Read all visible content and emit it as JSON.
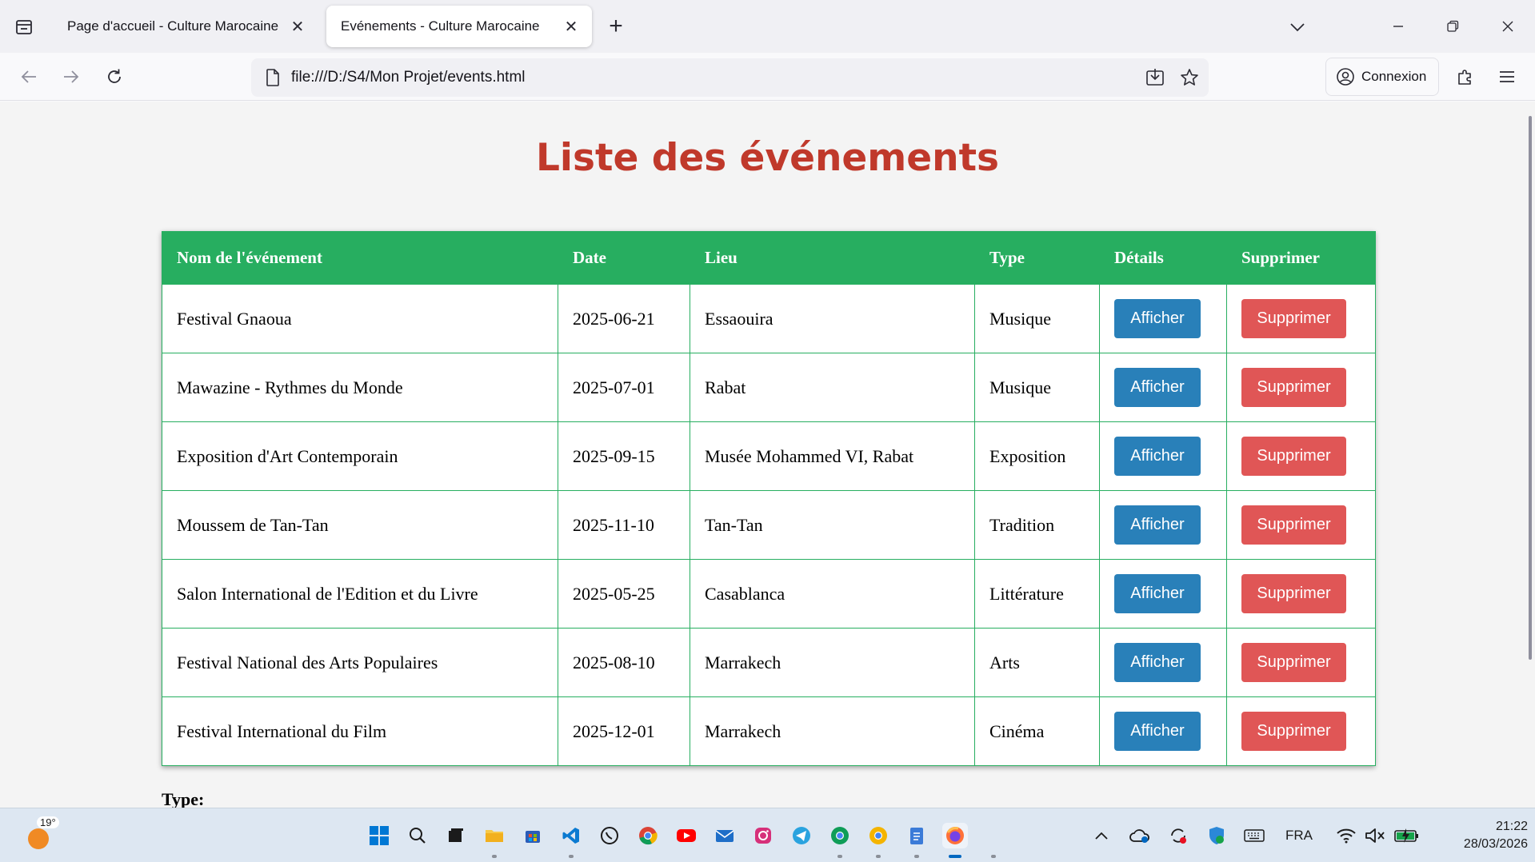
{
  "browser": {
    "tabs": [
      {
        "title": "Page d'accueil - Culture Marocaine",
        "active": false
      },
      {
        "title": "Evénements - Culture Marocaine",
        "active": true
      }
    ],
    "url": "file:///D:/S4/Mon Projet/events.html",
    "signin_label": "Connexion"
  },
  "page": {
    "title": "Liste des événements",
    "headers": [
      "Nom de l'événement",
      "Date",
      "Lieu",
      "Type",
      "Détails",
      "Supprimer"
    ],
    "rows": [
      {
        "name": "Festival Gnaoua",
        "date": "2025-06-21",
        "place": "Essaouira",
        "type": "Musique"
      },
      {
        "name": "Mawazine - Rythmes du Monde",
        "date": "2025-07-01",
        "place": "Rabat",
        "type": "Musique"
      },
      {
        "name": "Exposition d'Art Contemporain",
        "date": "2025-09-15",
        "place": "Musée Mohammed VI, Rabat",
        "type": "Exposition"
      },
      {
        "name": "Moussem de Tan-Tan",
        "date": "2025-11-10",
        "place": "Tan-Tan",
        "type": "Tradition"
      },
      {
        "name": "Salon International de l'Edition et du Livre",
        "date": "2025-05-25",
        "place": "Casablanca",
        "type": "Littérature"
      },
      {
        "name": "Festival National des Arts Populaires",
        "date": "2025-08-10",
        "place": "Marrakech",
        "type": "Arts"
      },
      {
        "name": "Festival International du Film",
        "date": "2025-12-01",
        "place": "Marrakech",
        "type": "Cinéma"
      }
    ],
    "show_label": "Afficher",
    "delete_label": "Supprimer",
    "type_label": "Type:"
  },
  "taskbar": {
    "temperature": "19°",
    "language": "FRA",
    "time": "21:22",
    "date": "28/03/2026"
  },
  "colors": {
    "title": "#c0392b",
    "table_header": "#27ae60",
    "show_button": "#2980b9",
    "delete_button": "#e05656"
  }
}
